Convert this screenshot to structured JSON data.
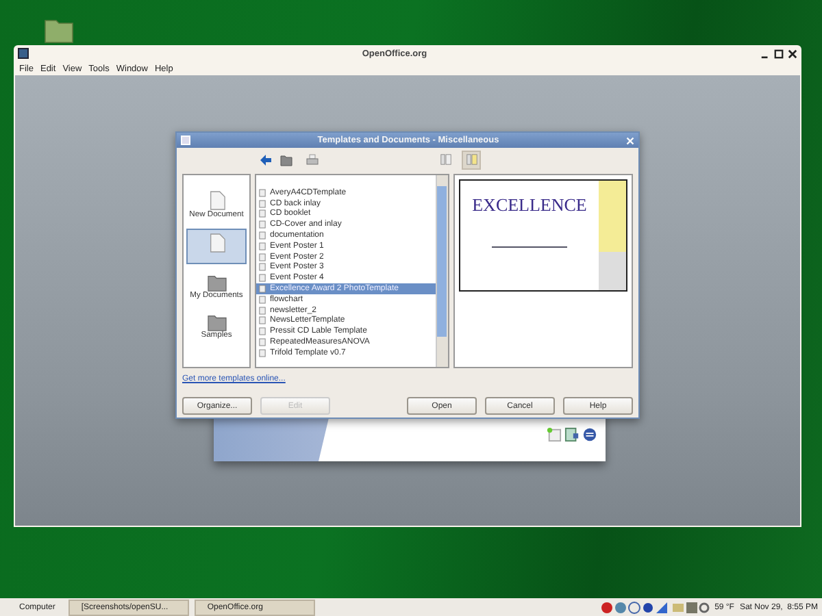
{
  "window": {
    "title": "OpenOffice.org",
    "menu": [
      {
        "label": "File"
      },
      {
        "label": "Edit"
      },
      {
        "label": "View"
      },
      {
        "label": "Tools"
      },
      {
        "label": "Window"
      },
      {
        "label": "Help"
      }
    ]
  },
  "dialog": {
    "title": "Templates and Documents - Miscellaneous",
    "view_modes": [
      {
        "selected": false
      },
      {
        "selected": true
      }
    ],
    "sidebar": [
      {
        "kind": "document",
        "label": "New Document",
        "selected": false
      },
      {
        "kind": "document",
        "selected": true
      },
      {
        "kind": "folder",
        "label": "My Documents",
        "selected": false
      },
      {
        "kind": "folder",
        "label": "Samples",
        "selected": false
      }
    ],
    "templates": [
      {
        "name": "AveryA4CDTemplate",
        "selected": false
      },
      {
        "name": "CD back inlay",
        "selected": false
      },
      {
        "name": "CD booklet",
        "selected": false
      },
      {
        "name": "CD-Cover and inlay",
        "selected": false
      },
      {
        "name": "documentation",
        "selected": false
      },
      {
        "name": "Event Poster 1",
        "selected": false
      },
      {
        "name": "Event Poster 2",
        "selected": false
      },
      {
        "name": "Event Poster 3",
        "selected": false
      },
      {
        "name": "Event Poster 4",
        "selected": false
      },
      {
        "name": "Excellence Award 2 PhotoTemplate",
        "selected": true
      },
      {
        "name": "flowchart",
        "selected": false
      },
      {
        "name": "newsletter_2",
        "selected": false
      },
      {
        "name": "NewsLetterTemplate",
        "selected": false
      },
      {
        "name": "Pressit CD Lable Template",
        "selected": false
      },
      {
        "name": "RepeatedMeasuresANOVA",
        "selected": false
      },
      {
        "name": "Trifold Template v0.7",
        "selected": false
      }
    ],
    "preview": {
      "title": "EXCELLENCE"
    },
    "link": "Get more templates online...",
    "buttons": [
      {
        "label": "Organize...",
        "disabled": false
      },
      {
        "label": "Edit",
        "disabled": true
      },
      {
        "label": "Open",
        "disabled": false
      },
      {
        "label": "Cancel",
        "disabled": false
      },
      {
        "label": "Help",
        "disabled": false
      }
    ]
  },
  "taskbar": {
    "start": "Computer",
    "tasks": [
      {
        "label": "[Screenshots/openSU..."
      },
      {
        "label": "OpenOffice.org"
      }
    ],
    "weather": "59 °F",
    "clock": "Sat Nov 29,  8:55 PM"
  }
}
